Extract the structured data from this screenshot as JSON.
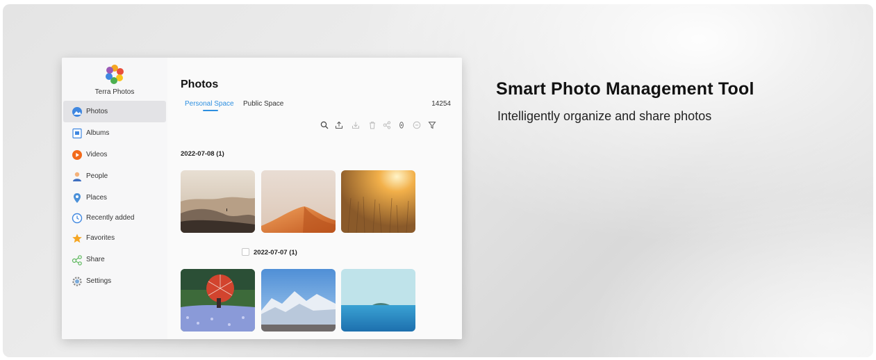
{
  "app": {
    "brand": "Terra Photos",
    "sidebar": {
      "items": [
        {
          "label": "Photos",
          "icon": "photos-icon",
          "active": true
        },
        {
          "label": "Albums",
          "icon": "albums-icon"
        },
        {
          "label": "Videos",
          "icon": "videos-icon"
        },
        {
          "label": "People",
          "icon": "people-icon"
        },
        {
          "label": "Places",
          "icon": "places-icon"
        },
        {
          "label": "Recently added",
          "icon": "recently-added-icon"
        },
        {
          "label": "Favorites",
          "icon": "favorites-icon"
        },
        {
          "label": "Share",
          "icon": "share-icon"
        },
        {
          "label": "Settings",
          "icon": "settings-icon"
        }
      ]
    },
    "main": {
      "title": "Photos",
      "tabs": [
        {
          "label": "Personal Space",
          "active": true
        },
        {
          "label": "Public Space"
        }
      ],
      "count": "14254",
      "toolbar": [
        "search-icon",
        "upload-icon",
        "download-icon",
        "delete-icon",
        "share-icon",
        "hide-icon",
        "more-icon",
        "filter-icon"
      ],
      "groups": [
        {
          "date": "2022-07-08 (1)",
          "photos": [
            "desert-dunes-hazy",
            "orange-sand-dune",
            "wheat-field-sunset"
          ]
        },
        {
          "date": "2022-07-07 (1)",
          "photos": [
            "red-umbrella-flowers",
            "snowy-mountains",
            "blue-sea-island"
          ]
        }
      ]
    },
    "colors": {
      "accent": "#2d8fe0"
    }
  },
  "promo": {
    "headline": "Smart Photo Management Tool",
    "subline": "Intelligently organize and share photos"
  }
}
